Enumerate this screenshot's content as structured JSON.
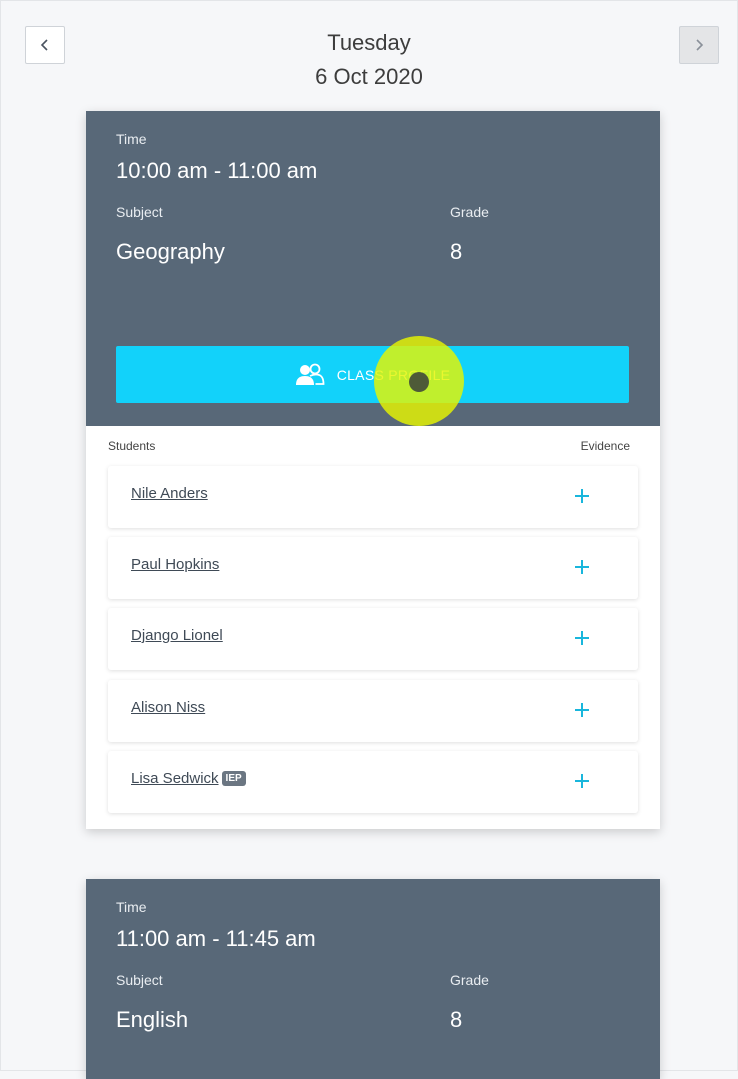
{
  "header": {
    "day": "Tuesday",
    "date": "6 Oct 2020",
    "prev_icon": "chevron-left-icon",
    "next_icon": "chevron-right-icon"
  },
  "labels": {
    "time": "Time",
    "subject": "Subject",
    "grade": "Grade",
    "students": "Students",
    "evidence": "Evidence",
    "class_profile": "CLASS PROFILE",
    "iep": "IEP"
  },
  "lessons": [
    {
      "time": "10:00 am - 11:00 am",
      "subject": "Geography",
      "grade": "8",
      "students": [
        {
          "name": "Nile Anders",
          "iep": false
        },
        {
          "name": "Paul Hopkins",
          "iep": false
        },
        {
          "name": "Django Lionel",
          "iep": false
        },
        {
          "name": "Alison Niss",
          "iep": false
        },
        {
          "name": "Lisa Sedwick",
          "iep": true
        }
      ]
    },
    {
      "time": "11:00 am - 11:45 am",
      "subject": "English",
      "grade": "8"
    }
  ],
  "colors": {
    "card_header": "#586878",
    "accent": "#12d2fa",
    "add_icon": "#19b6dc",
    "click_highlight": "#e6f500"
  }
}
